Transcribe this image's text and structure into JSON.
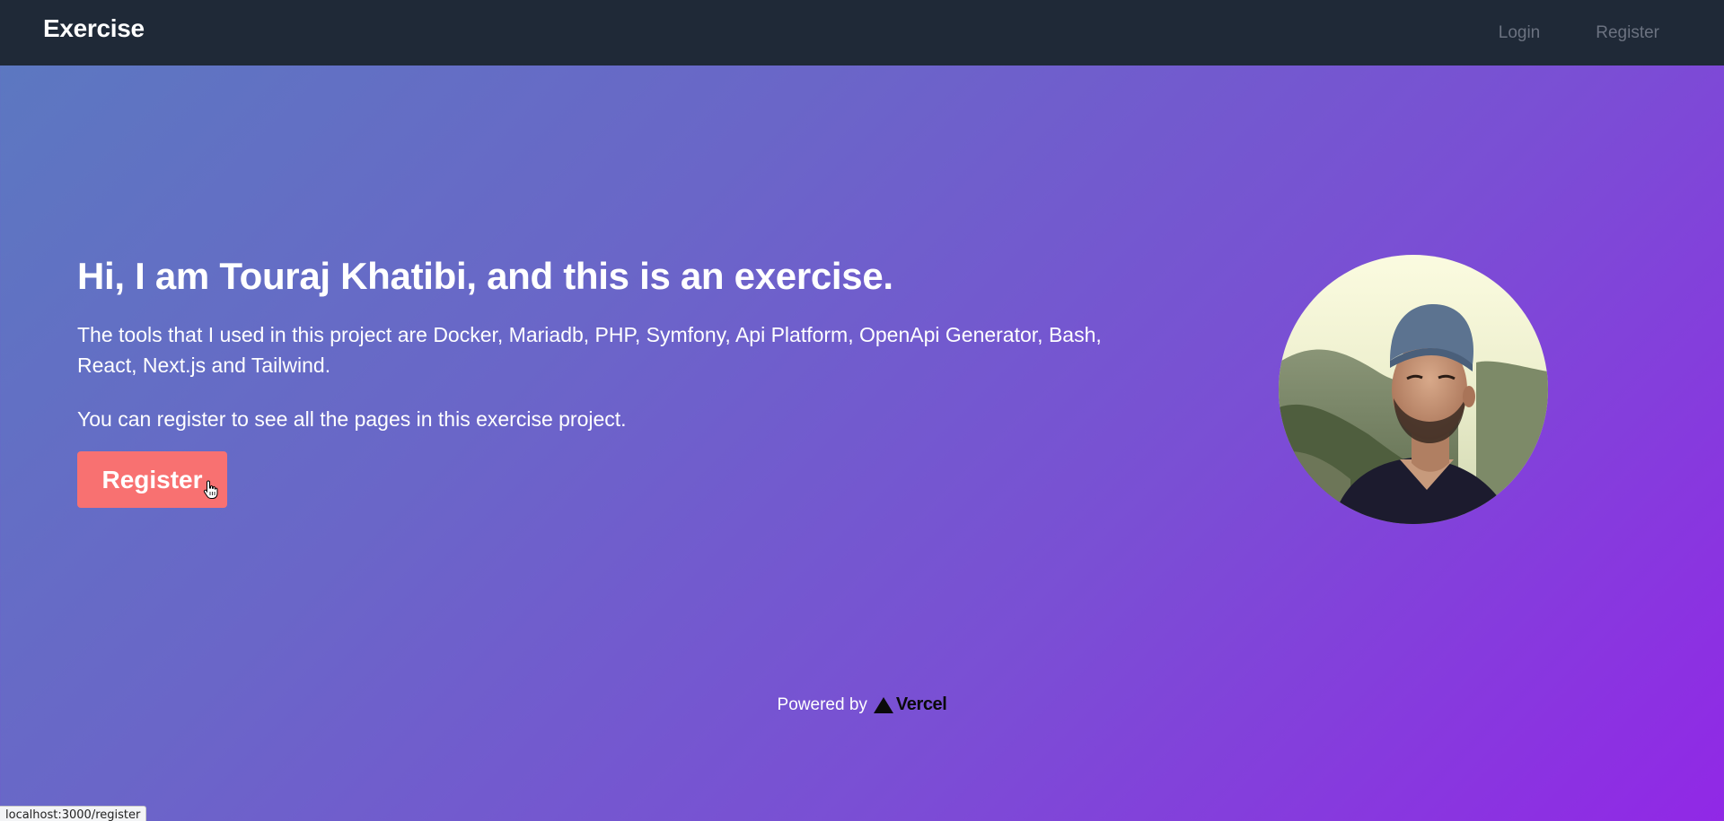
{
  "navbar": {
    "brand": "Exercise",
    "links": [
      "Login",
      "Register"
    ]
  },
  "hero": {
    "title": "Hi, I am Touraj Khatibi, and this is an exercise.",
    "tools_text": "The tools that I used in this project are Docker, Mariadb, PHP, Symfony, Api Platform, OpenApi Generator, Bash, React, Next.js and Tailwind.",
    "hint_text": "You can register to see all the pages in this exercise project.",
    "register_button": "Register"
  },
  "footer": {
    "powered_by": "Powered by",
    "vercel": "Vercel"
  },
  "status_bar": {
    "url": "localhost:3000/register"
  },
  "colors": {
    "navbar_bg": "#1f2937",
    "button_bg": "#f87171",
    "gradient_start": "#5b79c0",
    "gradient_end": "#9128e6"
  },
  "icons": {
    "cursor": "hand-pointer-icon",
    "vercel": "vercel-triangle-icon"
  }
}
